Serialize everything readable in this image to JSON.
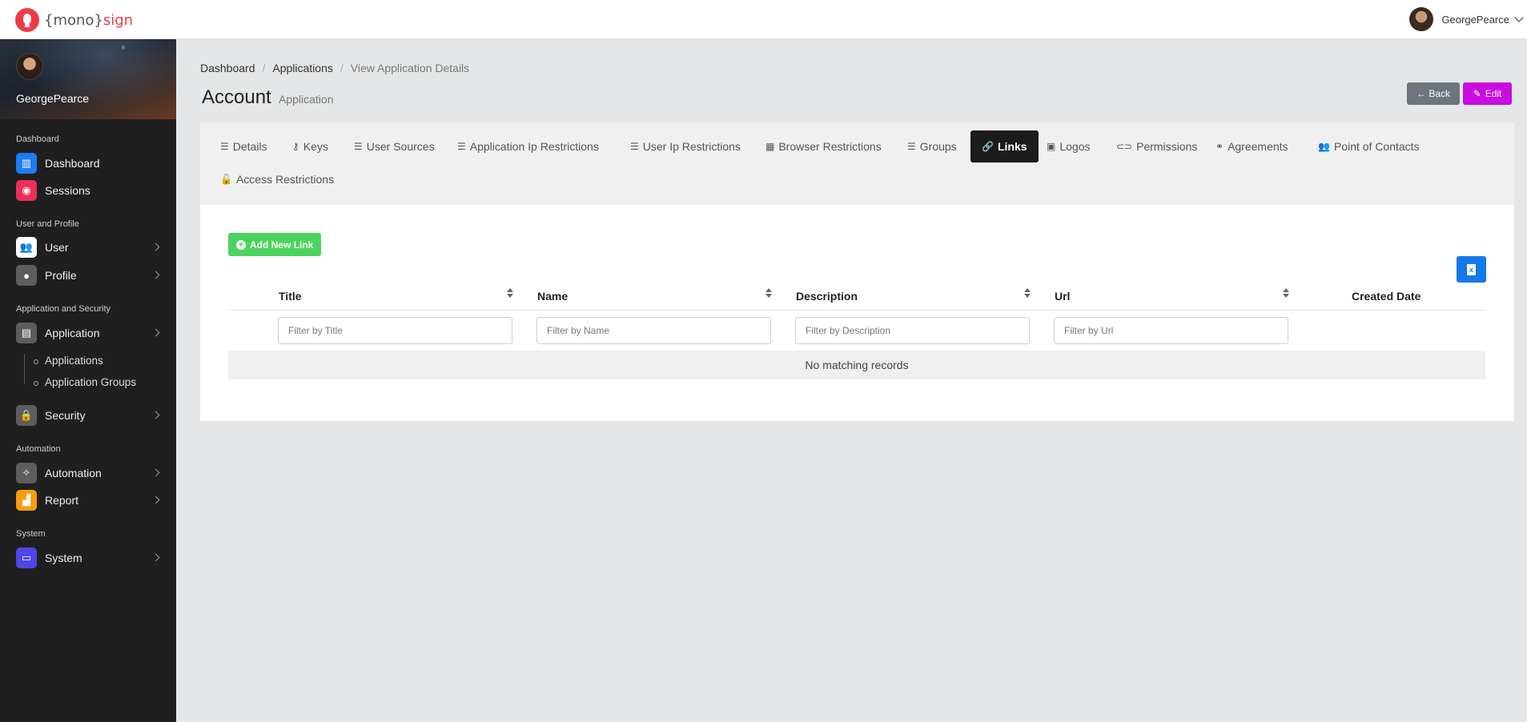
{
  "brand": {
    "prefix": "{mono}",
    "suffix": "sign"
  },
  "topbar": {
    "username": "GeorgePearce"
  },
  "sidebar": {
    "username": "GeorgePearce",
    "sections": {
      "dashboard": "Dashboard",
      "user_profile": "User and Profile",
      "app_security": "Application and Security",
      "automation": "Automation",
      "system": "System"
    },
    "items": {
      "dashboard": "Dashboard",
      "sessions": "Sessions",
      "user": "User",
      "profile": "Profile",
      "application": "Application",
      "applications": "Applications",
      "application_groups": "Application Groups",
      "security": "Security",
      "automation": "Automation",
      "report": "Report",
      "system": "System"
    },
    "colors": {
      "dashboard": "#1e7bf0",
      "sessions": "#ec2f57",
      "user": "#ffffff",
      "profile": "#5d5d5d",
      "application": "#5d5d5d",
      "security": "#5d5d5d",
      "automation": "#5d5d5d",
      "report": "#f59e0b",
      "system": "#5046e5"
    }
  },
  "breadcrumb": {
    "home": "Dashboard",
    "applications": "Applications",
    "current": "View Application Details"
  },
  "page": {
    "title": "Account",
    "subtitle": "Application"
  },
  "buttons": {
    "back": "← Back",
    "edit": "Edit",
    "add_link": "Add New Link"
  },
  "tabs": {
    "details": "Details",
    "keys": "Keys",
    "user_sources": "User Sources",
    "app_ip": "Application Ip Restrictions",
    "user_ip": "User Ip Restrictions",
    "browser": "Browser Restrictions",
    "groups": "Groups",
    "links": "Links",
    "logos": "Logos",
    "permissions": "Permissions",
    "agreements": "Agreements",
    "contacts": "Point of Contacts",
    "access": "Access Restrictions"
  },
  "table": {
    "columns": {
      "title": "Title",
      "name": "Name",
      "description": "Description",
      "url": "Url",
      "created": "Created Date"
    },
    "filters": {
      "title": "Filter by Title",
      "name": "Filter by Name",
      "description": "Filter by Description",
      "url": "Filter by Url"
    },
    "empty": "No matching records"
  }
}
